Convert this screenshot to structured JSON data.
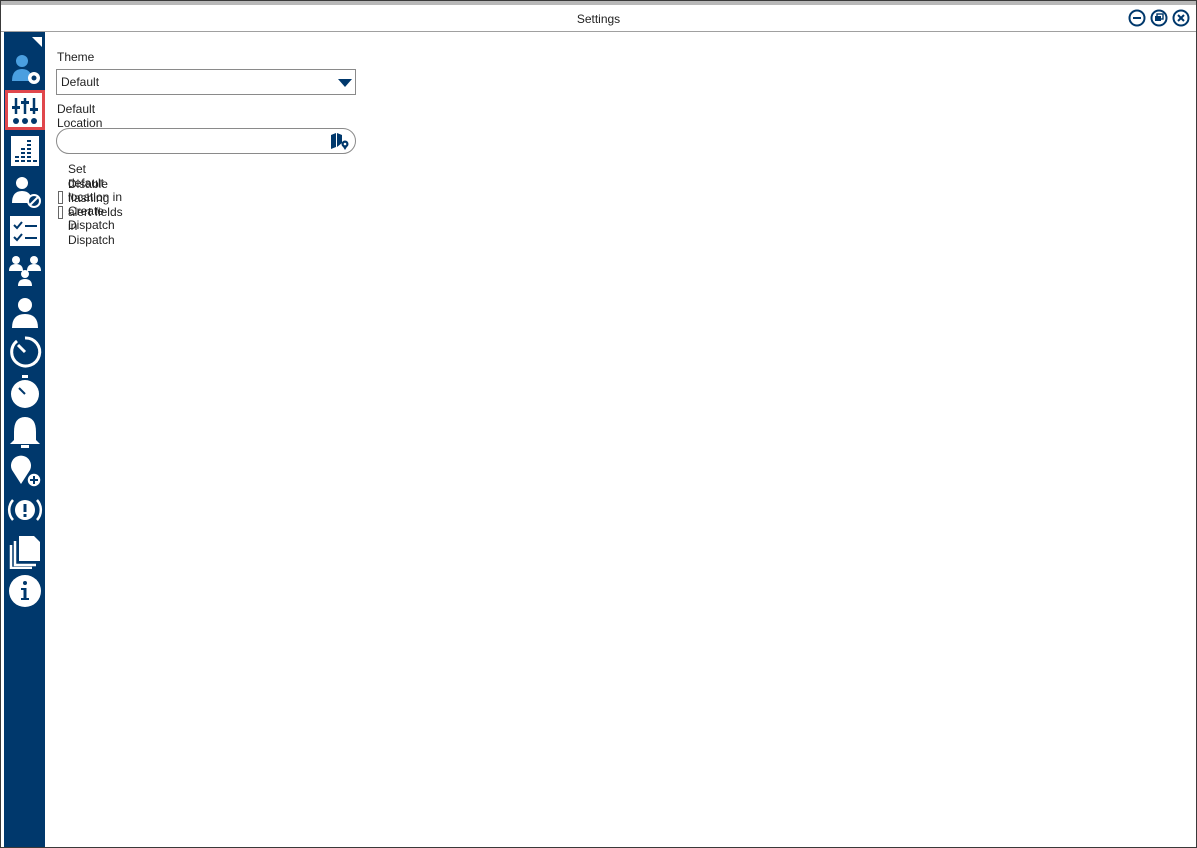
{
  "window": {
    "title": "Settings"
  },
  "colors": {
    "sidebar": "#00386c",
    "selected_outline": "#e0474c",
    "icon": "#ffffff",
    "accent": "#00386c"
  },
  "window_controls": [
    "minimize-icon",
    "restore-icon",
    "close-icon"
  ],
  "sidebar": {
    "items": [
      {
        "icon": "user-settings-icon"
      },
      {
        "icon": "sliders-icon",
        "selected": true
      },
      {
        "icon": "equalizer-list-icon"
      },
      {
        "icon": "user-blocked-icon"
      },
      {
        "icon": "checklist-icon"
      },
      {
        "icon": "user-group-icon"
      },
      {
        "icon": "user-icon"
      },
      {
        "icon": "timer-icon"
      },
      {
        "icon": "stopwatch-icon"
      },
      {
        "icon": "bell-icon"
      },
      {
        "icon": "add-location-icon"
      },
      {
        "icon": "alert-icon"
      },
      {
        "icon": "documents-icon"
      },
      {
        "icon": "info-icon"
      }
    ]
  },
  "settings": {
    "theme_label": "Theme",
    "theme_value": "Default",
    "location_label": "Default Location",
    "location_value": "",
    "checkbox_default_location": {
      "label": "Set default location in Create Dispatch",
      "checked": false
    },
    "checkbox_disable_flashing": {
      "label": "Disable flashing alert fields in Dispatch",
      "checked": false
    }
  }
}
